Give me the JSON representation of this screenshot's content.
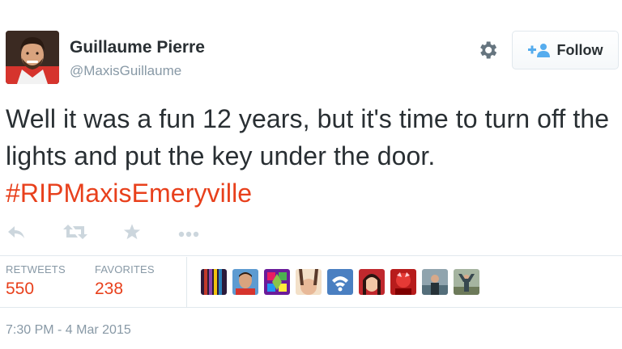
{
  "user": {
    "name": "Guillaume Pierre",
    "handle": "@MaxisGuillaume"
  },
  "follow_button": {
    "label": "Follow",
    "icon": "add-user-icon"
  },
  "settings_icon": "gear-icon",
  "tweet": {
    "text_plain": "Well it was a fun 12 years, but it's time to turn off the lights and put the key under the door. ",
    "hashtag": "#RIPMaxisEmeryville"
  },
  "actions": [
    {
      "icon": "reply-icon"
    },
    {
      "icon": "retweet-icon"
    },
    {
      "icon": "favorite-star-icon"
    },
    {
      "icon": "more-dots-icon"
    }
  ],
  "stats": {
    "retweets_label": "RETWEETS",
    "retweets_count": "550",
    "favorites_label": "FAVORITES",
    "favorites_count": "238"
  },
  "favoriter_avatars": 9,
  "timestamp": "7:30 PM - 4 Mar 2015",
  "colors": {
    "accent": "#e8401c",
    "text": "#292f33",
    "muted": "#8899a6",
    "border": "#e1e8ed"
  }
}
